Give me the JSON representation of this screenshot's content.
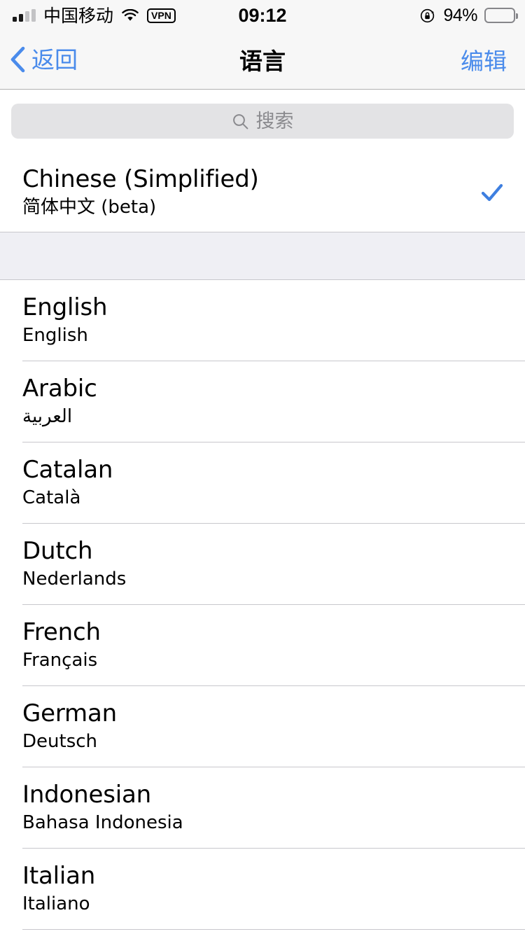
{
  "status_bar": {
    "carrier": "中国移动",
    "time": "09:12",
    "battery_percent": "94%",
    "signal_icon": "signal-bars-icon",
    "wifi_icon": "wifi-icon",
    "vpn_label": "VPN",
    "rotation_lock_icon": "rotation-lock-icon",
    "battery_icon": "battery-icon",
    "battery_level": 94
  },
  "nav_bar": {
    "back_label": "返回",
    "back_icon": "chevron-left-icon",
    "title": "语言",
    "edit_label": "编辑",
    "tint_color": "#4A8BEB"
  },
  "search": {
    "placeholder": "搜索",
    "icon": "search-icon",
    "value": ""
  },
  "selected_section": {
    "rows": [
      {
        "name": "Chinese (Simplified)",
        "native": "简体中文 (beta)",
        "selected": true,
        "check_icon": "checkmark-icon",
        "check_color": "#3E7FE0"
      }
    ]
  },
  "available_section": {
    "rows": [
      {
        "name": "English",
        "native": "English",
        "selected": false,
        "rtl": false
      },
      {
        "name": "Arabic",
        "native": "العربية",
        "selected": false,
        "rtl": true
      },
      {
        "name": "Catalan",
        "native": "Català",
        "selected": false,
        "rtl": false
      },
      {
        "name": "Dutch",
        "native": "Nederlands",
        "selected": false,
        "rtl": false
      },
      {
        "name": "French",
        "native": "Français",
        "selected": false,
        "rtl": false
      },
      {
        "name": "German",
        "native": "Deutsch",
        "selected": false,
        "rtl": false
      },
      {
        "name": "Indonesian",
        "native": "Bahasa Indonesia",
        "selected": false,
        "rtl": false
      },
      {
        "name": "Italian",
        "native": "Italiano",
        "selected": false,
        "rtl": false
      }
    ]
  },
  "colors": {
    "accent": "#4A8BEB",
    "checkmark": "#3E7FE0",
    "nav_background": "#F7F7F7",
    "search_field": "#E3E3E5",
    "separator": "#C8C7CC",
    "section_gap": "#EFEFF4",
    "placeholder_text": "#8A8A8E"
  }
}
